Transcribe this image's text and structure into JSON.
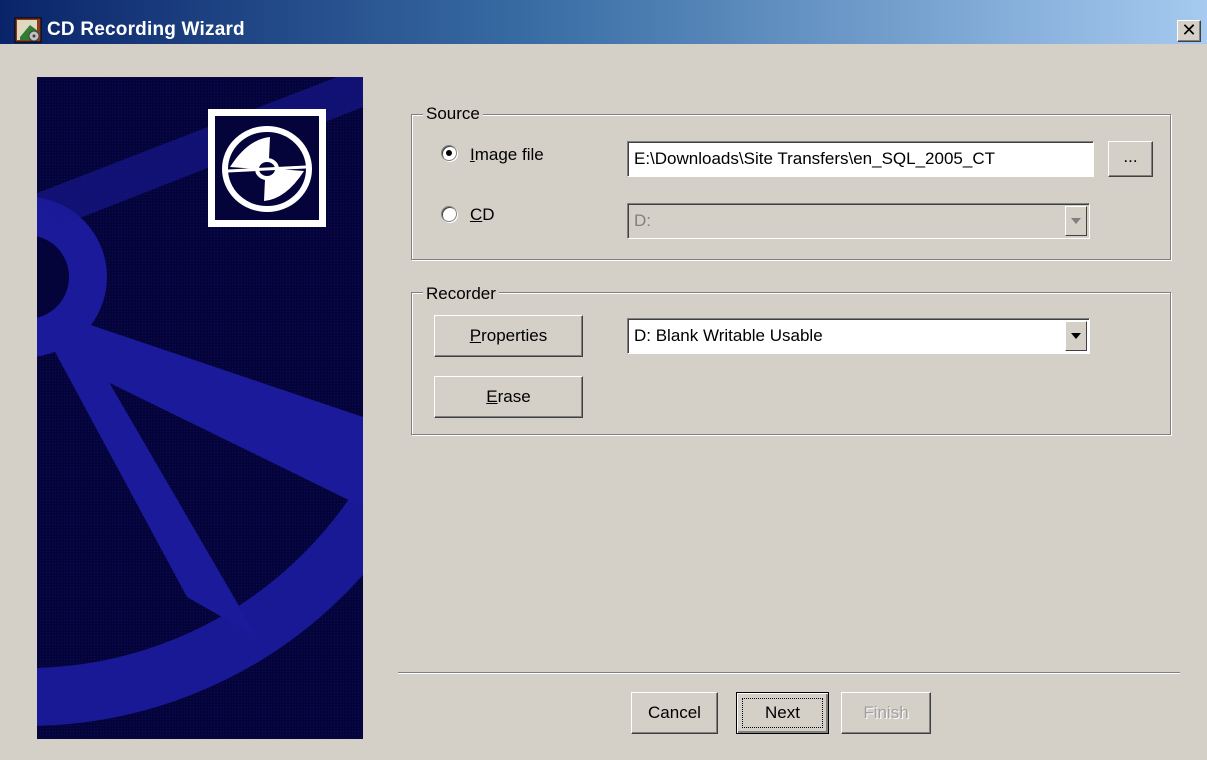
{
  "window": {
    "title": "CD Recording Wizard",
    "close_glyph": "✕"
  },
  "source": {
    "legend": "Source",
    "image_file": {
      "label_prefix": "",
      "label_mnemonic": "I",
      "label_rest": "mage file",
      "selected": true,
      "path_value": "E:\\Downloads\\Site Transfers\\en_SQL_2005_CT",
      "browse_label": "..."
    },
    "cd": {
      "label_mnemonic": "C",
      "label_rest": "D",
      "selected": false,
      "drive_value": "D:",
      "enabled": false
    }
  },
  "recorder": {
    "legend": "Recorder",
    "properties_mnemonic": "P",
    "properties_rest": "roperties",
    "erase_mnemonic": "E",
    "erase_rest": "rase",
    "device_value": "D: Blank Writable Usable"
  },
  "footer": {
    "cancel_label": "Cancel",
    "next_label": "Next",
    "finish_label": "Finish"
  },
  "colors": {
    "banner_bg": "#04043a",
    "banner_shape": "#1a1a9a",
    "dialog_bg": "#d4d0c8",
    "title_start": "#0a246a"
  },
  "icons": {
    "window_icon": "cd-recorder-icon",
    "banner_icon": "cd-disc-icon",
    "close_icon": "close-icon",
    "dropdown_icon": "chevron-down-icon"
  }
}
